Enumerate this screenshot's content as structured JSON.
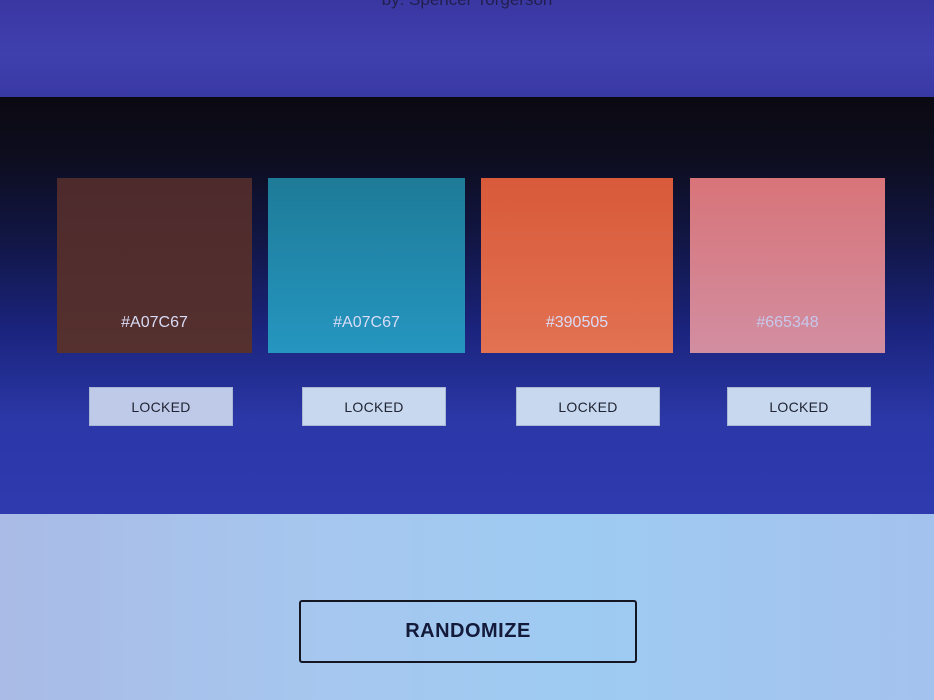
{
  "header": {
    "byline": "by: Spencer Torgerson"
  },
  "palette": {
    "swatches": [
      {
        "hex_label": "#A07C67",
        "fill_color": "#512d2e"
      },
      {
        "hex_label": "#A07C67",
        "fill_color": "#2189ad"
      },
      {
        "hex_label": "#390505",
        "fill_color": "#dd6646"
      },
      {
        "hex_label": "#665348",
        "fill_color": "#d58190"
      }
    ],
    "lock_buttons": [
      {
        "label": "LOCKED"
      },
      {
        "label": "LOCKED"
      },
      {
        "label": "LOCKED"
      },
      {
        "label": "LOCKED"
      }
    ]
  },
  "footer": {
    "randomize_label": "RANDOMIZE"
  },
  "colors": {
    "top_band": "#3c3aa8",
    "bottom_band": "#a4c5ee",
    "lock_button_bg": "#c8d9ef"
  }
}
